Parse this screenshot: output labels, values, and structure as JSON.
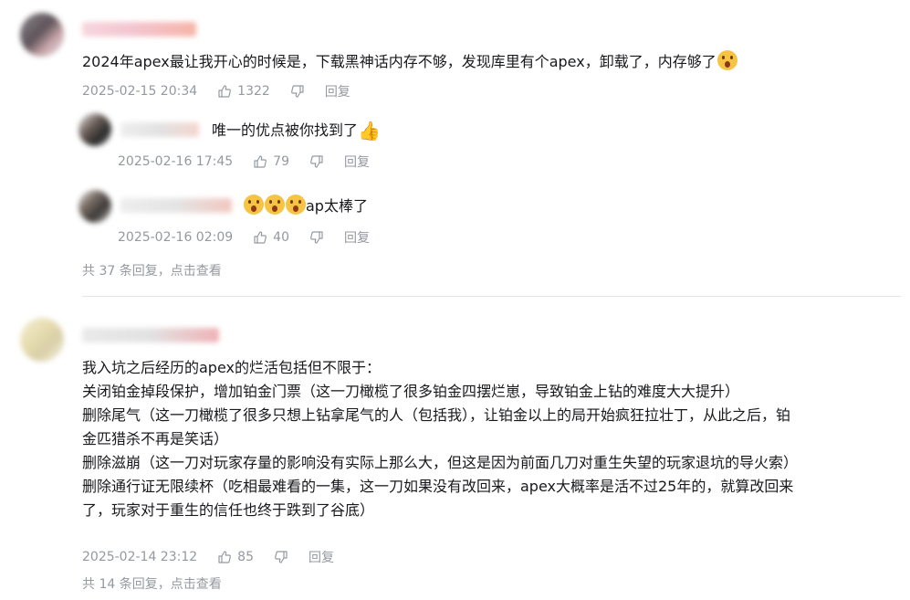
{
  "comments": [
    {
      "text": "2024年apex最让我开心的时候是，下载黑神话内存不够，发现库里有个apex，卸载了，内存够了",
      "date": "2025-02-15 20:34",
      "likes": "1322",
      "reply_label": "回复",
      "replies": [
        {
          "text": "唯一的优点被你找到了",
          "date": "2025-02-16 17:45",
          "likes": "79",
          "reply_label": "回复"
        },
        {
          "text": "ap太棒了",
          "date": "2025-02-16 02:09",
          "likes": "40",
          "reply_label": "回复"
        }
      ],
      "more_replies": "共 37 条回复，点击查看"
    },
    {
      "lines": [
        "我入坑之后经历的apex的烂活包括但不限于：",
        "关闭铂金掉段保护，增加铂金门票（这一刀橄榄了很多铂金四摆烂崽，导致铂金上钻的难度大大提升）",
        "删除尾气（这一刀橄榄了很多只想上钻拿尾气的人（包括我），让铂金以上的局开始疯狂拉壮丁，从此之后，铂",
        "金匹猎杀不再是笑话）",
        "删除滋崩（这一刀对玩家存量的影响没有实际上那么大，但这是因为前面几刀对重生失望的玩家退坑的导火索）",
        "删除通行证无限续杯（吃相最难看的一集，这一刀如果没有改回来，apex大概率是活不过25年的，就算改回来",
        "了，玩家对于重生的信任也终于跌到了谷底）"
      ],
      "date": "2025-02-14 23:12",
      "likes": "85",
      "reply_label": "回复",
      "more_replies": "共 14 条回复，点击查看"
    }
  ],
  "colors": {
    "meta": "#9499a0",
    "text": "#18191c",
    "divider": "#e3e5e7",
    "emoji": "#f6c344"
  }
}
